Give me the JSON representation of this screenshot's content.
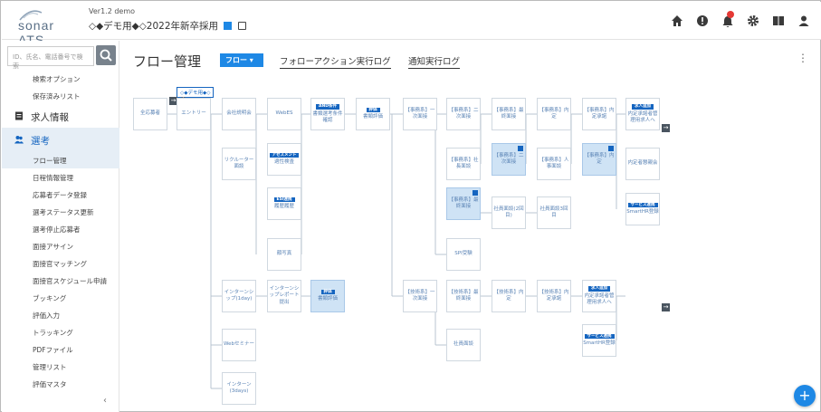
{
  "header": {
    "logo_text": "sonar ATS",
    "version": "Ver1.2 demo",
    "project": "◇◆デモ用◆◇2022年新卒採用"
  },
  "sidebar": {
    "search_placeholder": "ID、氏名、電話番号で検索",
    "items_top": [
      "検索オプション",
      "保存済みリスト"
    ],
    "section_jobs": "求人情報",
    "section_selection": "選考",
    "items": [
      "フロー管理",
      "日程情報管理",
      "応募者データ登録",
      "選考ステータス更新",
      "選考停止応募者",
      "面接アサイン",
      "面接官マッチング",
      "面接官スケジュール申請",
      "ブッキング",
      "評価入力",
      "トラッキング",
      "PDFファイル",
      "管理リスト",
      "評価マスタ"
    ]
  },
  "main": {
    "title": "フロー管理",
    "flow_button": "フロー",
    "tab_follow": "フォローアクション実行ログ",
    "tab_notify": "通知実行ログ"
  },
  "flow_pill": "◇◆デモ用◆◇",
  "nodes": [
    {
      "label": "全応募者"
    },
    {
      "label": "エントリー"
    },
    {
      "label": "会社説明会"
    },
    {
      "label": "WebES"
    },
    {
      "tag": "AND条件",
      "label": "書類選考条件確認"
    },
    {
      "tag": "評価",
      "label": "書類評価"
    },
    {
      "label": "【事務系】一次面接"
    },
    {
      "label": "【事務系】二次面接"
    },
    {
      "label": "【事務系】最終面接"
    },
    {
      "label": "【事務系】内定"
    },
    {
      "label": "【事務系】内定承諾"
    },
    {
      "tag": "求人追加",
      "label": "内定承諾者管理用求人へ"
    },
    {
      "label": "リクルーター面談"
    },
    {
      "tag": "アセスメント",
      "label": "適性検査"
    },
    {
      "label": "【事務系】社長面談"
    },
    {
      "label": "【事務系】二次面接"
    },
    {
      "label": "【事務系】人事面談"
    },
    {
      "label": "【事務系】内定"
    },
    {
      "label": "内定者懇親会"
    },
    {
      "tag": "ESI連携",
      "label": "履歴履歴"
    },
    {
      "label": "【事務系】最終面接"
    },
    {
      "label": "社員面談(2回目)"
    },
    {
      "label": "社員面談3回目"
    },
    {
      "tag": "サービス連携",
      "label": "SmartHR登録"
    },
    {
      "label": "SPI受験"
    },
    {
      "label": "顔写真"
    },
    {
      "label": "インターンシップ(1day)"
    },
    {
      "label": "インターンシップレポート提出"
    },
    {
      "tag": "評価",
      "label": "書類評価"
    },
    {
      "label": "【技術系】一次面接"
    },
    {
      "label": "【技術系】最終面接"
    },
    {
      "label": "【技術系】内定"
    },
    {
      "label": "【技術系】内定承諾"
    },
    {
      "tag": "求人追加",
      "label": "内定承諾者管理用求人へ"
    },
    {
      "label": "社員面談"
    },
    {
      "tag": "サービス連携",
      "label": "SmartHR登録"
    },
    {
      "label": "Webセミナー"
    },
    {
      "label": "インターン(3days)"
    }
  ]
}
